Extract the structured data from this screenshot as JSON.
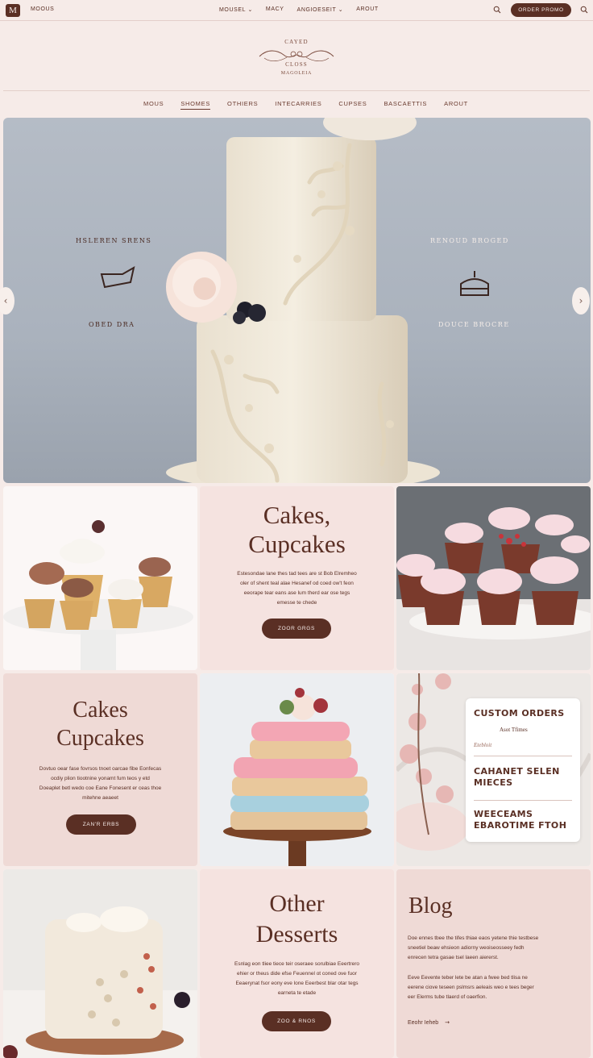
{
  "header": {
    "logo_letter": "M",
    "site_name": "MOOUS",
    "nav": [
      "MOUSEL ⌄",
      "MACY",
      "ANGIOESEIT ⌄",
      "AROUT"
    ],
    "order_button": "ORDER PROMO",
    "search_icon": "search-icon"
  },
  "brand": {
    "line1": "CAYED",
    "line2": "CLOSS",
    "line3": "MAGOLEIA"
  },
  "mainnav": [
    "MOUS",
    "SHOMES",
    "OTHIERS",
    "INTECARRIES",
    "CUPSES",
    "BASCAETTIS",
    "AROUT"
  ],
  "hero": {
    "left_badge_top": "HSLEREN SRENS",
    "left_badge_bottom": "OBED DRA",
    "right_badge_top": "RENOUD BROGED",
    "right_badge_bottom": "DOUCE BROCRE",
    "prev_icon": "chevron-left-icon",
    "next_icon": "chevron-right-icon"
  },
  "tile_cakes_cupcakes": {
    "title_line1": "Cakes,",
    "title_line2": "Cupcakes",
    "body": [
      "Estesondae lane thes tad tees are st Bob Elremheo",
      "oler of shent teal alae Hesanef od coed ow't feon",
      "eeorape tear eans ase lum therd ear ose tegs",
      "emesse te chede"
    ],
    "button": "ZOOR GRGS"
  },
  "tile_cakes_cupcakes_2": {
    "title_line1": "Cakes",
    "title_line2": "Cupcakes",
    "body": [
      "Dovtuo oear fase fovrsos tnoet oarcae fibe Eonfecas",
      "ocdiy plion tiootnine yonamt fum teos y etd",
      "Doeaplet betl wedo coe Eane Fonesent er ceas thoe",
      "mitehne aeaeet"
    ],
    "button": "ZAN'R ERBS"
  },
  "custom_orders": {
    "heading": "CUSTOM ORDERS",
    "subheading": "Asot Tfimes",
    "script_line": "Etebloit",
    "item1": "CAHANET SELEN MIECES",
    "item2": "WEECEAMS EBAROTIME FTOH"
  },
  "tile_other_desserts": {
    "title_line1": "Other",
    "title_line2": "Desserts",
    "body": [
      "Esnlag eon tliee tiece teir oseraee sorulbiae Eeertrero",
      "ehier or theus dide efse Feuennel ot coned ove fuor",
      "Eeaerynat fsor eony eve lone Eeerbest blar otar tegs",
      "earneta te etade"
    ],
    "button": "ZOO & RNOS"
  },
  "blog": {
    "title": "Blog",
    "para1": [
      "Doe ennes tbee the tifes thiae eaos yetene thie testbese",
      "sneetiel beaw ehsieon adiorny weoiseosseey fedh",
      "enrecen tetra gasae tsel laeen aiererst."
    ],
    "para2": [
      "Eeve Eevente teber lete be atan a fwee bed tlisa ne",
      "eerene ciove teseen pslmsrs aeleais weo e tees beger",
      "eer Elerms tube tlaerd of oaerfion."
    ],
    "read_more": "Eeohr Ieheb",
    "arrow_icon": "arrow-right-icon"
  }
}
